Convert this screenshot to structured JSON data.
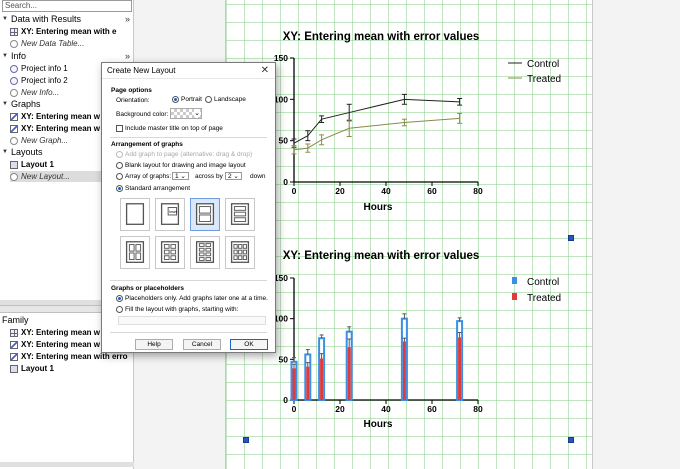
{
  "navigator": {
    "search_placeholder": "Search...",
    "sections": [
      {
        "label": "Data with Results",
        "items": [
          {
            "label": "XY: Entering mean with e",
            "bold": true,
            "icon": "table-icon"
          },
          {
            "label": "New Data Table...",
            "italic": true,
            "icon": "add-icon"
          }
        ]
      },
      {
        "label": "Info",
        "items": [
          {
            "label": "Project info 1",
            "icon": "info-icon"
          },
          {
            "label": "Project info 2",
            "icon": "info-icon"
          },
          {
            "label": "New Info...",
            "italic": true,
            "icon": "add-icon"
          }
        ]
      },
      {
        "label": "Graphs",
        "items": [
          {
            "label": "XY: Entering mean w",
            "bold": true,
            "icon": "graph-icon"
          },
          {
            "label": "XY: Entering mean w",
            "bold": true,
            "icon": "graph-icon"
          },
          {
            "label": "New Graph...",
            "italic": true,
            "icon": "add-icon"
          }
        ]
      },
      {
        "label": "Layouts",
        "items": [
          {
            "label": "Layout 1",
            "bold": true,
            "icon": "layout-icon"
          },
          {
            "label": "New Layout...",
            "italic": true,
            "icon": "add-icon"
          }
        ]
      }
    ],
    "family": {
      "label": "Family",
      "items": [
        {
          "label": "XY: Entering mean w",
          "icon": "table-icon"
        },
        {
          "label": "XY: Entering mean w",
          "icon": "graph-icon"
        },
        {
          "label": "XY: Entering mean with erro",
          "icon": "graph-icon"
        },
        {
          "label": "Layout 1",
          "icon": "layout-icon"
        }
      ]
    }
  },
  "dialog": {
    "title": "Create New Layout",
    "page_options": "Page options",
    "orientation_label": "Orientation:",
    "portrait": "Portrait",
    "landscape": "Landscape",
    "bg_color_label": "Background color:",
    "master_title": "Include master title on top of page",
    "arrangement_heading": "Arrangement of graphs",
    "opt_add_graph": "Add graph to page (alternative: drag & drop)",
    "opt_blank": "Blank layout for drawing and image layout",
    "opt_array": "Array of graphs:",
    "array_rows": "1",
    "across_by": "across by",
    "array_cols": "2",
    "down": "down",
    "opt_standard": "Standard arrangement",
    "inset_label": "Inset",
    "placeholders_heading": "Graphs or placeholders",
    "opt_placeholders": "Placeholders only. Add graphs later one at a time.",
    "opt_fill": "Fill the layout with graphs, starting with:",
    "help": "Help",
    "cancel": "Cancel",
    "ok": "OK"
  },
  "chart_data": [
    {
      "type": "line",
      "title": "XY: Entering mean with error values",
      "xlabel": "Hours",
      "ylabel": "",
      "xlim": [
        0,
        80
      ],
      "ylim": [
        0,
        150
      ],
      "xticks": [
        0,
        20,
        40,
        60,
        80
      ],
      "yticks": [
        0,
        50,
        100,
        150
      ],
      "x": [
        0,
        6,
        12,
        24,
        48,
        72
      ],
      "series": [
        {
          "name": "Control",
          "color": "#222222",
          "values": [
            47,
            56,
            76,
            84,
            100,
            97
          ],
          "errors": [
            5,
            6,
            4,
            10,
            6,
            4
          ]
        },
        {
          "name": "Treated",
          "color": "#8a8a4a",
          "values": [
            39,
            41,
            51,
            65,
            72,
            77
          ],
          "errors": [
            5,
            5,
            6,
            10,
            4,
            6
          ]
        }
      ],
      "legend": "top-right"
    },
    {
      "type": "bar",
      "title": "XY: Entering mean with error values",
      "xlabel": "Hours",
      "ylabel": "",
      "xlim": [
        0,
        80
      ],
      "ylim": [
        0,
        150
      ],
      "xticks": [
        0,
        20,
        40,
        60,
        80
      ],
      "yticks": [
        0,
        50,
        100,
        150
      ],
      "x": [
        0,
        6,
        12,
        24,
        48,
        72
      ],
      "series": [
        {
          "name": "Control",
          "color": "#3b8fe6",
          "values": [
            47,
            56,
            76,
            84,
            100,
            97
          ],
          "errors": [
            5,
            6,
            4,
            6,
            6,
            4
          ]
        },
        {
          "name": "Treated",
          "color": "#e03a3a",
          "values": [
            39,
            41,
            51,
            65,
            72,
            77
          ],
          "errors": [
            5,
            5,
            6,
            10,
            4,
            6
          ]
        }
      ],
      "legend": "top-right"
    }
  ]
}
